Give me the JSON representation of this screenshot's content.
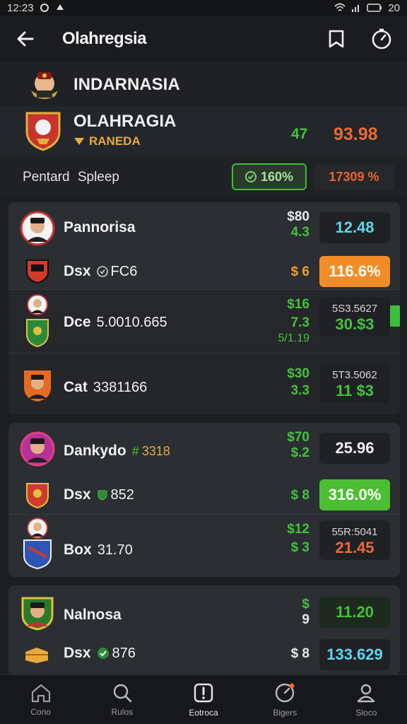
{
  "status_bar": {
    "time": "12:23",
    "battery": "20"
  },
  "app_bar": {
    "title": "Olahregsia"
  },
  "header": {
    "team_name": "INDARNASIA",
    "club_name": "OLAHRAGIA",
    "club_sub": "RANEDA",
    "delta": "47",
    "score": "93.98",
    "summary_label": "Pentard  Spleep",
    "pill_green": "160%",
    "pill_orange": "17309 %"
  },
  "cards": [
    {
      "rows": [
        {
          "name": "Pannorisa",
          "meta": "",
          "odds_top": "$80",
          "odds_bottom": "4.3",
          "value": "12.48",
          "value_color": "#5ed6f0"
        },
        {
          "name": "Dsx",
          "meta": "FC6",
          "odds_top": "$ 6",
          "odds_bottom": "",
          "value": "116.6%",
          "value_color": "#ffffff"
        },
        {
          "name": "Dce",
          "meta": "5.0010.665",
          "odds_top": "$16",
          "odds_bottom": "7.3",
          "odds_extra": "5/1.19",
          "value_small": "5S3.5627",
          "value": "30.$3"
        },
        {
          "name": "Cat",
          "meta": "3381166",
          "odds_top": "$30",
          "odds_bottom": "3.3",
          "value_small": "5T3.5062",
          "value": "11 $3"
        }
      ]
    },
    {
      "rows": [
        {
          "name": "Dankydo",
          "meta": "3318",
          "odds_top": "$70",
          "odds_bottom": "$.2",
          "value": "25.96"
        },
        {
          "name": "Dsx",
          "meta": "852",
          "odds_top": "$ 8",
          "odds_bottom": "",
          "value": "316.0%"
        },
        {
          "name": "Box",
          "meta": "31.70",
          "odds_top": "$12",
          "odds_bottom": "$ 3",
          "value_small": "55R:5041",
          "value": "21.45"
        }
      ]
    },
    {
      "rows": [
        {
          "name": "Nalnosa",
          "meta": "",
          "odds_top": "$",
          "odds_bottom": "9",
          "value": "11.20"
        },
        {
          "name": "Dsx",
          "meta": "876",
          "odds_top": "$ 8",
          "odds_bottom": "",
          "value": "133.629"
        }
      ]
    }
  ],
  "bottom_nav": [
    {
      "label": "Cono",
      "icon": "home-icon"
    },
    {
      "label": "Rulos",
      "icon": "search-icon"
    },
    {
      "label": "Eotroca",
      "icon": "alert-icon"
    },
    {
      "label": "Bigers",
      "icon": "stats-icon"
    },
    {
      "label": "Sioco",
      "icon": "profile-icon"
    }
  ],
  "colors": {
    "accent_green": "#44c23c",
    "accent_orange": "#ee6a2d",
    "accent_cyan": "#5ed6f0"
  }
}
